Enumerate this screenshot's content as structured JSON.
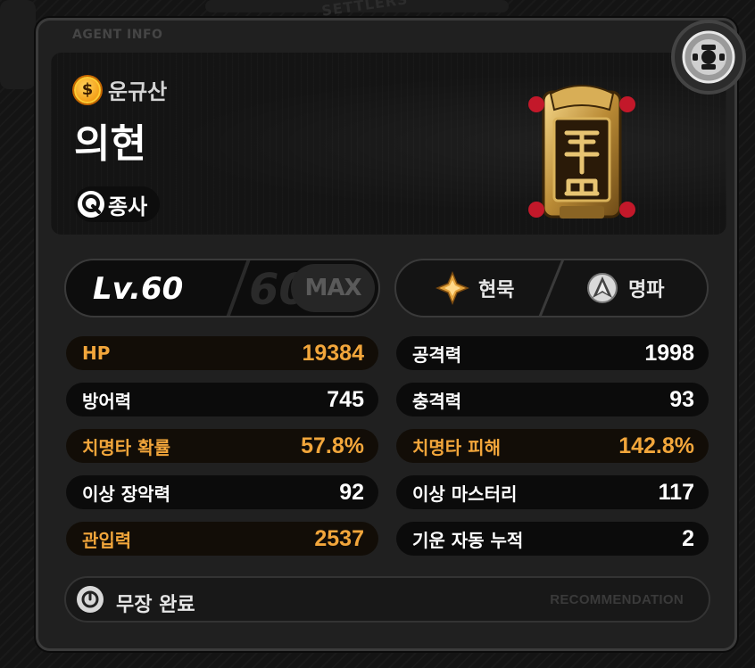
{
  "panel": {
    "tab_label": "AGENT INFO"
  },
  "background": {
    "watermark": "SETTLERS"
  },
  "agent": {
    "faction": "운규산",
    "name": "의현",
    "role": "종사",
    "faction_icon": "dollar-coin-icon",
    "role_icon": "q-role-icon"
  },
  "level": {
    "label": "Lv.60",
    "ghost": "60",
    "max": "MAX"
  },
  "attributes": {
    "left": {
      "label": "현묵",
      "icon": "auric-ink-icon"
    },
    "right": {
      "label": "명파",
      "icon": "pierce-icon"
    }
  },
  "stats": {
    "left": [
      {
        "label": "HP",
        "value": "19384",
        "highlight": true
      },
      {
        "label": "방어력",
        "value": "745",
        "highlight": false
      },
      {
        "label": "치명타 확률",
        "value": "57.8%",
        "highlight": true
      },
      {
        "label": "이상 장악력",
        "value": "92",
        "highlight": false
      },
      {
        "label": "관입력",
        "value": "2537",
        "highlight": true
      }
    ],
    "right": [
      {
        "label": "공격력",
        "value": "1998",
        "highlight": false
      },
      {
        "label": "충격력",
        "value": "93",
        "highlight": false
      },
      {
        "label": "치명타 피해",
        "value": "142.8%",
        "highlight": true
      },
      {
        "label": "이상 마스터리",
        "value": "117",
        "highlight": false
      },
      {
        "label": "기운 자동 누적",
        "value": "2",
        "highlight": false
      }
    ]
  },
  "footer": {
    "label": "무장 완료",
    "recommendation": "RECOMMENDATION"
  },
  "colors": {
    "highlight": "#f2a63b",
    "panel": "#202020",
    "row": "#0b0b0b"
  }
}
